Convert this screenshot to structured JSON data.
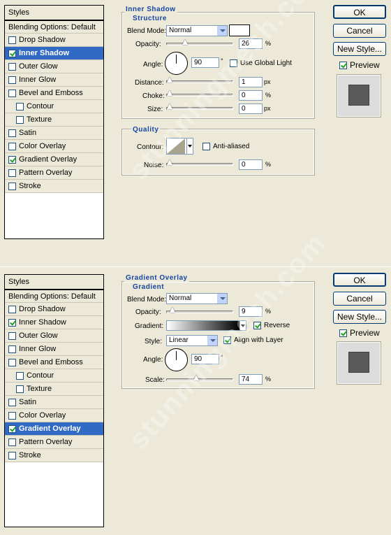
{
  "panel1": {
    "styles_title": "Styles",
    "items": [
      {
        "label": "Blending Options: Default",
        "checkbox": false,
        "checked": false,
        "selected": false,
        "sub": false
      },
      {
        "label": "Drop Shadow",
        "checkbox": true,
        "checked": false,
        "selected": false,
        "sub": false
      },
      {
        "label": "Inner Shadow",
        "checkbox": true,
        "checked": true,
        "selected": true,
        "sub": false
      },
      {
        "label": "Outer Glow",
        "checkbox": true,
        "checked": false,
        "selected": false,
        "sub": false
      },
      {
        "label": "Inner Glow",
        "checkbox": true,
        "checked": false,
        "selected": false,
        "sub": false
      },
      {
        "label": "Bevel and Emboss",
        "checkbox": true,
        "checked": false,
        "selected": false,
        "sub": false
      },
      {
        "label": "Contour",
        "checkbox": true,
        "checked": false,
        "selected": false,
        "sub": true
      },
      {
        "label": "Texture",
        "checkbox": true,
        "checked": false,
        "selected": false,
        "sub": true
      },
      {
        "label": "Satin",
        "checkbox": true,
        "checked": false,
        "selected": false,
        "sub": false
      },
      {
        "label": "Color Overlay",
        "checkbox": true,
        "checked": false,
        "selected": false,
        "sub": false
      },
      {
        "label": "Gradient Overlay",
        "checkbox": true,
        "checked": true,
        "selected": false,
        "sub": false
      },
      {
        "label": "Pattern Overlay",
        "checkbox": true,
        "checked": false,
        "selected": false,
        "sub": false
      },
      {
        "label": "Stroke",
        "checkbox": true,
        "checked": false,
        "selected": false,
        "sub": false
      }
    ],
    "section_title": "Inner Shadow",
    "structure_title": "Structure",
    "blend_mode_label": "Blend Mode:",
    "blend_mode_value": "Normal",
    "opacity_label": "Opacity:",
    "opacity_value": "26",
    "angle_label": "Angle:",
    "angle_value": "90",
    "degree": "°",
    "global_light_label": "Use Global Light",
    "distance_label": "Distance:",
    "distance_value": "1",
    "choke_label": "Choke:",
    "choke_value": "0",
    "size_label": "Size:",
    "size_value": "0",
    "quality_title": "Quality",
    "contour_label": "Contour:",
    "anti_aliased_label": "Anti-aliased",
    "noise_label": "Noise:",
    "noise_value": "0",
    "pct": "%",
    "px": "px"
  },
  "panel2": {
    "styles_title": "Styles",
    "items": [
      {
        "label": "Blending Options: Default",
        "checkbox": false,
        "checked": false,
        "selected": false,
        "sub": false
      },
      {
        "label": "Drop Shadow",
        "checkbox": true,
        "checked": false,
        "selected": false,
        "sub": false
      },
      {
        "label": "Inner Shadow",
        "checkbox": true,
        "checked": true,
        "selected": false,
        "sub": false
      },
      {
        "label": "Outer Glow",
        "checkbox": true,
        "checked": false,
        "selected": false,
        "sub": false
      },
      {
        "label": "Inner Glow",
        "checkbox": true,
        "checked": false,
        "selected": false,
        "sub": false
      },
      {
        "label": "Bevel and Emboss",
        "checkbox": true,
        "checked": false,
        "selected": false,
        "sub": false
      },
      {
        "label": "Contour",
        "checkbox": true,
        "checked": false,
        "selected": false,
        "sub": true
      },
      {
        "label": "Texture",
        "checkbox": true,
        "checked": false,
        "selected": false,
        "sub": true
      },
      {
        "label": "Satin",
        "checkbox": true,
        "checked": false,
        "selected": false,
        "sub": false
      },
      {
        "label": "Color Overlay",
        "checkbox": true,
        "checked": false,
        "selected": false,
        "sub": false
      },
      {
        "label": "Gradient Overlay",
        "checkbox": true,
        "checked": true,
        "selected": true,
        "sub": false
      },
      {
        "label": "Pattern Overlay",
        "checkbox": true,
        "checked": false,
        "selected": false,
        "sub": false
      },
      {
        "label": "Stroke",
        "checkbox": true,
        "checked": false,
        "selected": false,
        "sub": false
      }
    ],
    "section_title": "Gradient Overlay",
    "gradient_title": "Gradient",
    "blend_mode_label": "Blend Mode:",
    "blend_mode_value": "Normal",
    "opacity_label": "Opacity:",
    "opacity_value": "9",
    "gradient_label": "Gradient:",
    "reverse_label": "Reverse",
    "style_label": "Style:",
    "style_value": "Linear",
    "align_label": "Align with Layer",
    "angle_label": "Angle:",
    "angle_value": "90",
    "degree": "°",
    "scale_label": "Scale:",
    "scale_value": "74",
    "pct": "%"
  },
  "buttons": {
    "ok": "OK",
    "cancel": "Cancel",
    "new_style": "New Style...",
    "preview": "Preview"
  },
  "watermark": "stunningmesh.com",
  "colors": {
    "accent": "#316ac5",
    "section_title": "#1746a3",
    "background": "#ece9d8"
  }
}
